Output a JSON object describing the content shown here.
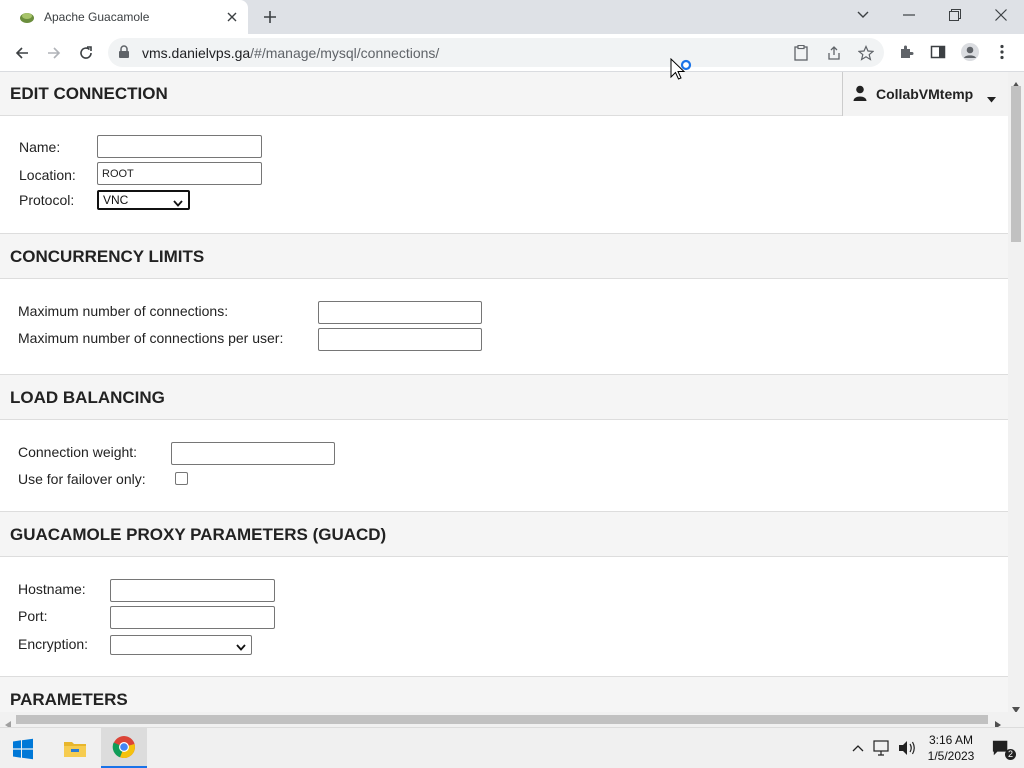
{
  "browser": {
    "tab_title": "Apache Guacamole",
    "url_host": "vms.danielvps.ga",
    "url_path": "/#/manage/mysql/connections/"
  },
  "header": {
    "title": "EDIT CONNECTION",
    "username": "CollabVMtemp"
  },
  "connection": {
    "name_label": "Name:",
    "name_value": "",
    "location_label": "Location:",
    "location_value": "ROOT",
    "protocol_label": "Protocol:",
    "protocol_value": "VNC"
  },
  "concurrency": {
    "title": "CONCURRENCY LIMITS",
    "max_connections_label": "Maximum number of connections:",
    "max_connections_value": "",
    "max_per_user_label": "Maximum number of connections per user:",
    "max_per_user_value": ""
  },
  "load_balancing": {
    "title": "LOAD BALANCING",
    "weight_label": "Connection weight:",
    "weight_value": "",
    "failover_label": "Use for failover only:",
    "failover_checked": false
  },
  "guacd": {
    "title": "GUACAMOLE PROXY PARAMETERS (GUACD)",
    "hostname_label": "Hostname:",
    "hostname_value": "",
    "port_label": "Port:",
    "port_value": "",
    "encryption_label": "Encryption:",
    "encryption_value": ""
  },
  "parameters": {
    "title": "PARAMETERS"
  },
  "taskbar": {
    "time": "3:16 AM",
    "date": "1/5/2023",
    "notification_count": "2"
  },
  "colors": {
    "section_bg": "#f5f5f5",
    "chrome_tabstrip": "#dee1e6",
    "accent_blue": "#1a73e8"
  }
}
